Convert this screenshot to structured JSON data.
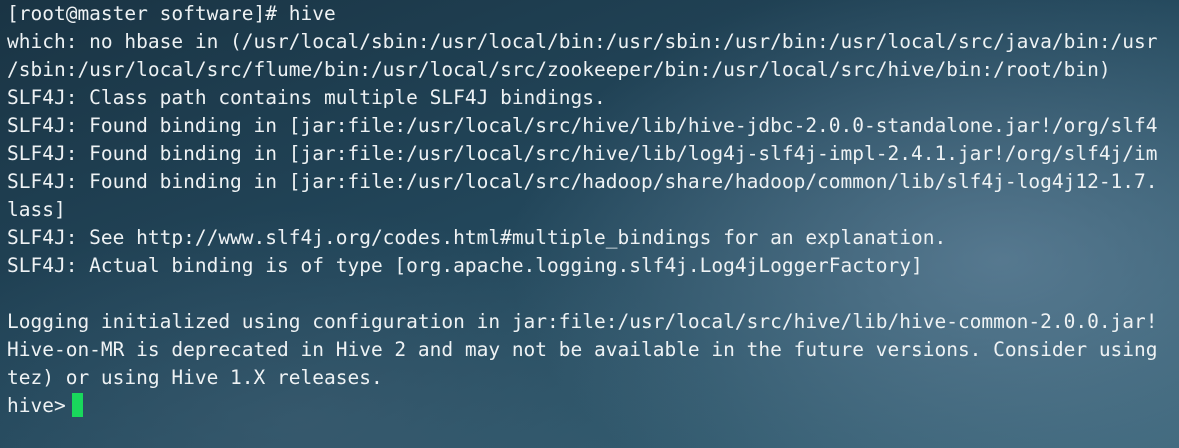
{
  "terminal": {
    "lines": [
      "[root@master software]# hive",
      "which: no hbase in (/usr/local/sbin:/usr/local/bin:/usr/sbin:/usr/bin:/usr/local/src/java/bin:/usr",
      "/sbin:/usr/local/src/flume/bin:/usr/local/src/zookeeper/bin:/usr/local/src/hive/bin:/root/bin)",
      "SLF4J: Class path contains multiple SLF4J bindings.",
      "SLF4J: Found binding in [jar:file:/usr/local/src/hive/lib/hive-jdbc-2.0.0-standalone.jar!/org/slf4",
      "SLF4J: Found binding in [jar:file:/usr/local/src/hive/lib/log4j-slf4j-impl-2.4.1.jar!/org/slf4j/im",
      "SLF4J: Found binding in [jar:file:/usr/local/src/hadoop/share/hadoop/common/lib/slf4j-log4j12-1.7.",
      "lass]",
      "SLF4J: See http://www.slf4j.org/codes.html#multiple_bindings for an explanation.",
      "SLF4J: Actual binding is of type [org.apache.logging.slf4j.Log4jLoggerFactory]",
      "",
      "Logging initialized using configuration in jar:file:/usr/local/src/hive/lib/hive-common-2.0.0.jar!",
      "Hive-on-MR is deprecated in Hive 2 and may not be available in the future versions. Consider using",
      "tez) or using Hive 1.X releases."
    ],
    "prompt": "hive>",
    "cursor_color": "#19d85c"
  }
}
